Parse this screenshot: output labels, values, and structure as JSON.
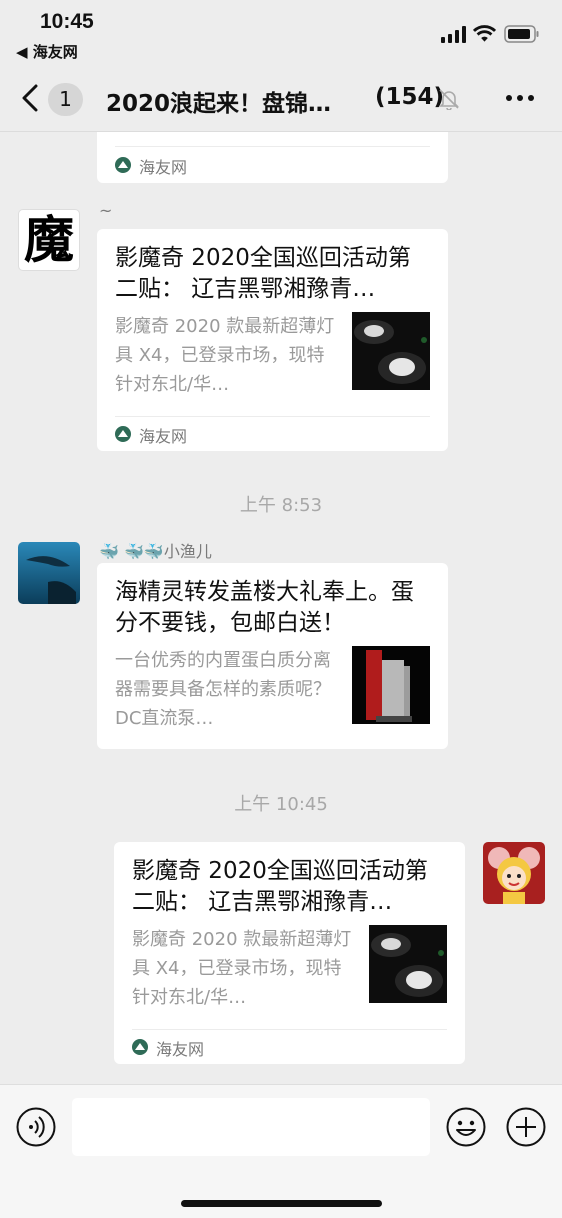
{
  "status": {
    "time": "10:45",
    "back_app": "◀ 海友网"
  },
  "nav": {
    "unread": "1",
    "title": "2020浪起来！盘锦…",
    "count": "(154)"
  },
  "messages": {
    "first": {
      "source": "海友网"
    },
    "second": {
      "sender": "~",
      "title": "影魔奇 2020全国巡回活动第二贴： 辽吉黑鄂湘豫青…",
      "desc": "影魔奇 2020 款最新超薄灯具 X4，已登录市场，现特针对东北/华…",
      "source": "海友网"
    },
    "time1": "上午 8:53",
    "third": {
      "sender": "🐳 🐳🐳小渔儿",
      "title": "海精灵转发盖楼大礼奉上。蛋分不要钱，包邮白送！",
      "desc": "一台优秀的内置蛋白质分离器需要具备怎样的素质呢？DC直流泵…"
    },
    "time2": "上午 10:45",
    "fourth": {
      "title": "影魔奇 2020全国巡回活动第二贴： 辽吉黑鄂湘豫青…",
      "desc": "影魔奇 2020 款最新超薄灯具 X4，已登录市场，现特针对东北/华…",
      "source": "海友网"
    }
  },
  "avatar2_text": "魔",
  "colors": {
    "background": "#ededed",
    "card": "#ffffff",
    "muted_text": "#9a9a9a"
  }
}
